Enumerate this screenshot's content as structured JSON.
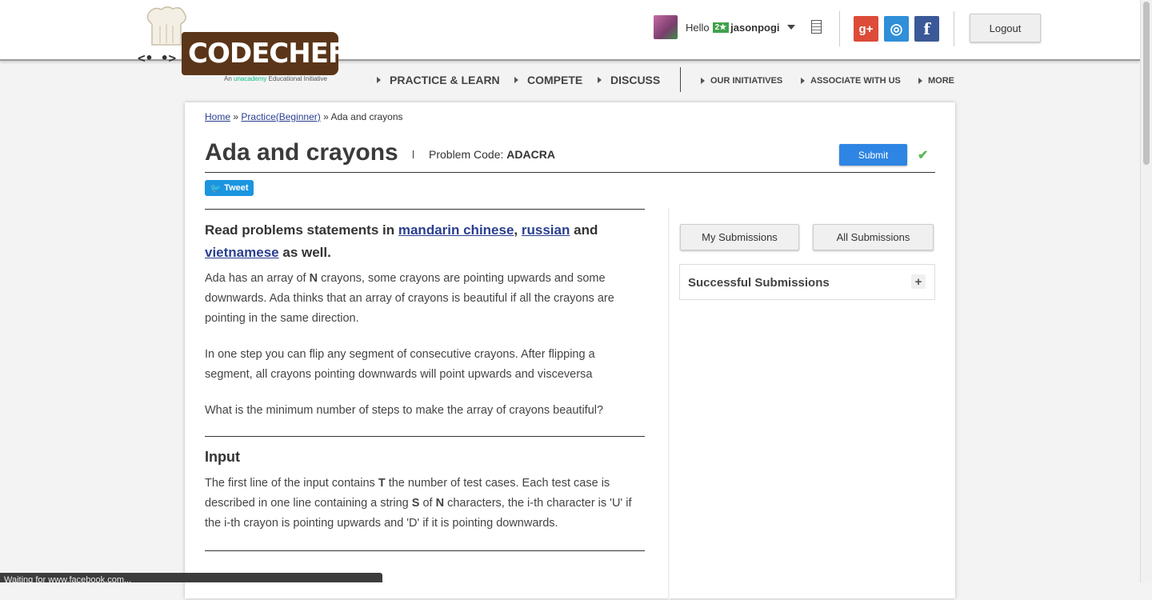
{
  "header": {
    "logo_text": "CODECHEF",
    "tagline_prefix": "An",
    "tagline_brand": "unacademy",
    "tagline_suffix": "Educational Initiative",
    "greeting": "Hello",
    "star_rating": "2★",
    "username": "jasonpogi",
    "social": {
      "gplus": "g+",
      "github": "◎",
      "facebook": "f"
    },
    "logout_label": "Logout"
  },
  "nav": {
    "primary": [
      "PRACTICE & LEARN",
      "COMPETE",
      "DISCUSS"
    ],
    "secondary": [
      "OUR INITIATIVES",
      "ASSOCIATE WITH US",
      "MORE"
    ]
  },
  "breadcrumb": {
    "home": "Home",
    "sep": "»",
    "practice": "Practice(Beginner)",
    "current": "Ada and crayons"
  },
  "problem": {
    "title": "Ada and crayons",
    "code_label": "Problem Code:",
    "code": "ADACRA",
    "submit_label": "Submit",
    "tweet_label": "Tweet"
  },
  "statement": {
    "read_prefix": "Read problems statements in",
    "lang1": "mandarin chinese",
    "comma": ",",
    "lang2": "russian",
    "and": "and",
    "lang3": "vietnamese",
    "read_suffix": "as well.",
    "p1_a": "Ada has an array of",
    "p1_n": "N",
    "p1_b": "crayons, some crayons are pointing upwards and some downwards. Ada thinks that an array of crayons is beautiful if all the crayons are pointing in the same direction.",
    "p2": "In one step you can flip any segment of consecutive crayons. After flipping a segment, all crayons pointing downwards will point upwards and visceversa",
    "p3": "What is the minimum number of steps to make the array of crayons beautiful?",
    "input_heading": "Input",
    "in_a": "The first line of the input contains",
    "in_t": "T",
    "in_b": "the number of test cases. Each test case is described in one line containing a string",
    "in_s": "S",
    "in_c": "of",
    "in_n": "N",
    "in_d": "characters, the i-th character is 'U' if the i-th crayon is pointing upwards and 'D' if it is pointing downwards."
  },
  "sidebar": {
    "my_submissions": "My Submissions",
    "all_submissions": "All Submissions",
    "successful_submissions": "Successful Submissions",
    "expand": "+"
  },
  "status_bar": "Waiting for www.facebook.com..."
}
